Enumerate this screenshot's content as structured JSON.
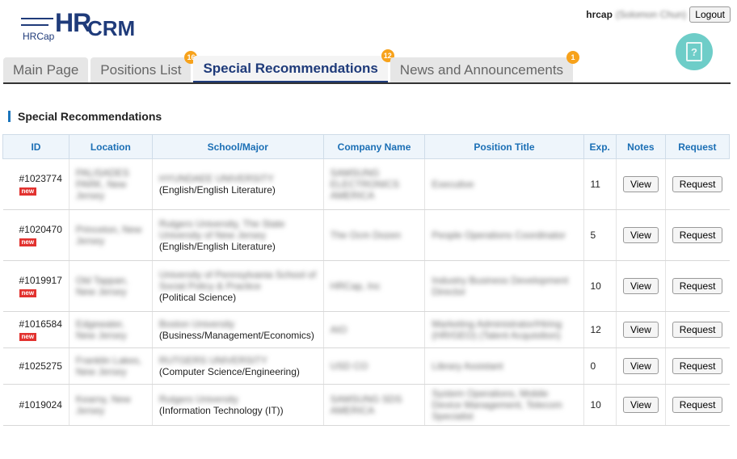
{
  "header": {
    "logo_hr": "HR",
    "logo_cap": "HRCap",
    "logo_crm": "CRM",
    "username": "hrcap",
    "user_fullname": "(Solomon Chun)",
    "logout_label": "Logout"
  },
  "tabs": [
    {
      "label": "Main Page",
      "badge": ""
    },
    {
      "label": "Positions List",
      "badge": "16"
    },
    {
      "label": "Special Recommendations",
      "badge": "12",
      "active": true
    },
    {
      "label": "News and Announcements",
      "badge": "1"
    }
  ],
  "section_title": "Special Recommendations",
  "table": {
    "headers": {
      "id": "ID",
      "location": "Location",
      "school": "School/Major",
      "company": "Company Name",
      "position": "Position Title",
      "exp": "Exp.",
      "notes": "Notes",
      "request": "Request"
    },
    "view_label": "View",
    "request_label": "Request",
    "new_label": "new",
    "rows": [
      {
        "id": "#1023774",
        "location": "PALISADES PARK, New Jersey",
        "school": "HYUNDAEE UNIVERSITY",
        "major": "(English/English Literature)",
        "company": "SAMSUNG ELECTRONICS AMERICA",
        "position": "Executive",
        "exp": "11"
      },
      {
        "id": "#1020470",
        "location": "Princeton, New Jersey",
        "school": "Rutgers University, The State University of New Jersey",
        "major": "(English/English Literature)",
        "company": "The Ocm Dozen",
        "position": "People Operations Coordinator",
        "exp": "5"
      },
      {
        "id": "#1019917",
        "location": "Old Tappan, New Jersey",
        "school": "University of Pennsylvania School of Social Policy & Practice",
        "major": "(Political Science)",
        "company": "HRCap, Inc",
        "position": "Industry Business Development Director",
        "exp": "10"
      },
      {
        "id": "#1016584",
        "location": "Edgewater, New Jersey",
        "school": "Boston University",
        "major": "(Business/Management/Economics)",
        "company": "AIO",
        "position": "Marketing Administrator/Hiring (HR/GEO) (Talent Acquisition)",
        "exp": "12"
      },
      {
        "id": "#1025275",
        "location": "Franklin Lakes, New Jersey",
        "school": "RUTGERS UNIVERSITY",
        "major": "(Computer Science/Engineering)",
        "company": "USD CO",
        "position": "Library Assistant",
        "exp": "0"
      },
      {
        "id": "#1019024",
        "location": "Kearny, New Jersey",
        "school": "Rutgers University",
        "major": "(Information Technology (IT))",
        "company": "SAMSUNG SDS AMERICA",
        "position": "System Operations, Mobile Device Management, Telecom Specialist",
        "exp": "10"
      }
    ],
    "new_flags": [
      true,
      true,
      true,
      true,
      false,
      false
    ]
  }
}
